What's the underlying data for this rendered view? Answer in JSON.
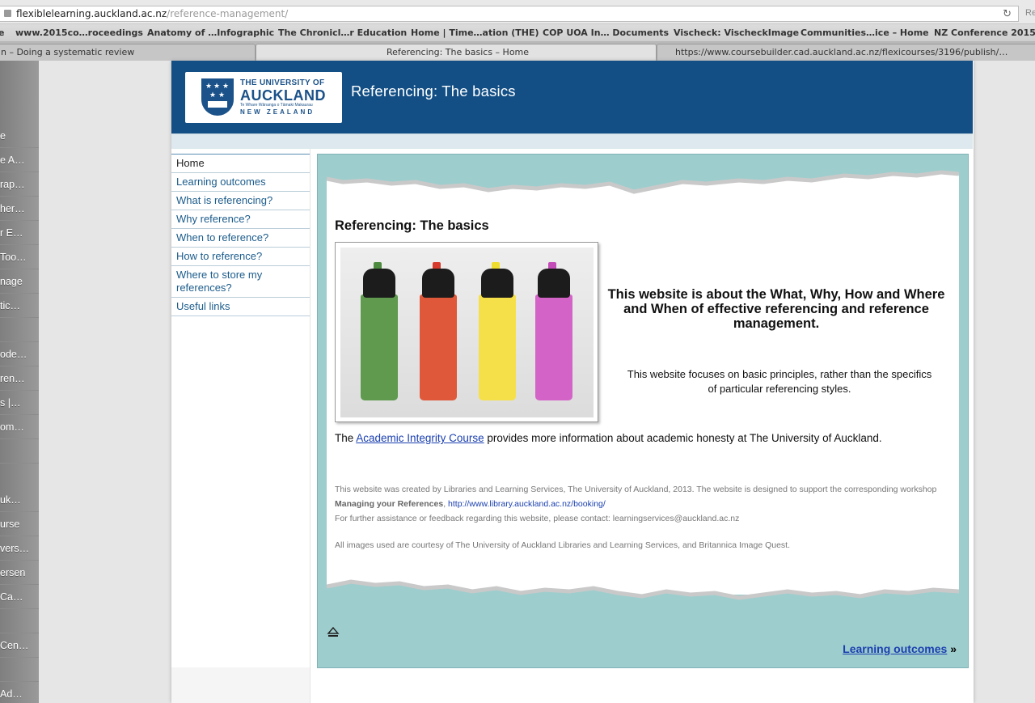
{
  "browser": {
    "url_host": "flexiblelearning.auckland.ac.nz",
    "url_path": "/reference-management/",
    "reload_icon": "reload-icon",
    "right_stub": "Re",
    "bookmarks": [
      "e",
      "www.2015co…roceedings",
      "Anatomy of …Infographic",
      "The Chronicl…r Education",
      "Home | Time…ation (THE)",
      "COP UOA In… Documents",
      "Vischeck: VischeckImage",
      "Communities…ice – Home",
      "NZ Conference 2015"
    ],
    "tabs": [
      "n – Doing a systematic review",
      "Referencing: The basics – Home",
      "https://www.coursebuilder.cad.auckland.ac.nz/flexicourses/3196/publish/…"
    ]
  },
  "sidebar": {
    "items": [
      "e",
      "e A…",
      "rap…",
      "her…",
      "r E…",
      "Too…",
      "nage",
      "tic…",
      "",
      "ode…",
      "ren…",
      "s |…",
      "om…",
      "",
      "uk…",
      "urse",
      "vers…",
      "ersen",
      "Ca…",
      "",
      "Cen…",
      "",
      "Ad…"
    ]
  },
  "banner": {
    "logo_line1": "THE UNIVERSITY OF",
    "logo_line2": "AUCKLAND",
    "logo_line3": "Te Whare Wānanga o Tāmaki Makaurau",
    "logo_line4": "NEW ZEALAND",
    "site_title": "Referencing: The basics"
  },
  "nav": {
    "items": [
      "Home",
      "Learning outcomes",
      "What is referencing?",
      "Why reference?",
      "When to reference?",
      "How to reference?",
      "Where to store my references?",
      "Useful links"
    ]
  },
  "content": {
    "title": "Referencing: The basics",
    "lead": "This website is about the What, Why, How and Where and When of effective referencing and reference management.",
    "sub": "This website focuses on basic principles, rather than the specifics of particular referencing styles.",
    "integrity_prefix": "The ",
    "integrity_link": "Academic Integrity Course",
    "integrity_suffix": " provides more information about academic honesty at The University of Auckland.",
    "fine_line1": "This website was created by Libraries and Learning Services, The University of Auckland, 2013. The website is designed to support the corresponding workshop ",
    "fine_bold": "Managing your References",
    "fine_comma": ", ",
    "fine_link": "http://www.library.auckland.ac.nz/booking/",
    "fine_line2": "For further assistance or feedback regarding this website, please contact: learningservices@auckland.ac.nz",
    "credit": "All images used are courtesy of The University of Auckland Libraries and Learning Services, and Britannica Image Quest.",
    "next_link": "Learning outcomes",
    "next_arrow": "»",
    "marker_colors": [
      "#5f9a4f",
      "#e0583a",
      "#f5e04a",
      "#d463c8"
    ],
    "marker_tip_colors": [
      "#4d8a3f",
      "#d63a2c",
      "#eedd2c",
      "#c44cb8"
    ]
  },
  "colors": {
    "banner": "#134f85",
    "content_bg": "#9ecdcd",
    "link": "#1a3fb0"
  }
}
